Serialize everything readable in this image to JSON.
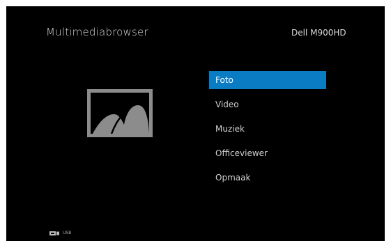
{
  "app": {
    "title": "Multimediabrowser",
    "device": "Dell M900HD"
  },
  "preview": {
    "icon": "photo-icon"
  },
  "menu": {
    "selected_index": 0,
    "items": [
      {
        "label": "Foto"
      },
      {
        "label": "Video"
      },
      {
        "label": "Muziek"
      },
      {
        "label": "Officeviewer"
      },
      {
        "label": "Opmaak"
      }
    ]
  },
  "source": {
    "icon": "usb-icon",
    "label": "USB"
  },
  "colors": {
    "background": "#000000",
    "highlight": "#0a7cc4",
    "text": "#d0d0d0",
    "icon_gray": "#8c8c8c"
  }
}
